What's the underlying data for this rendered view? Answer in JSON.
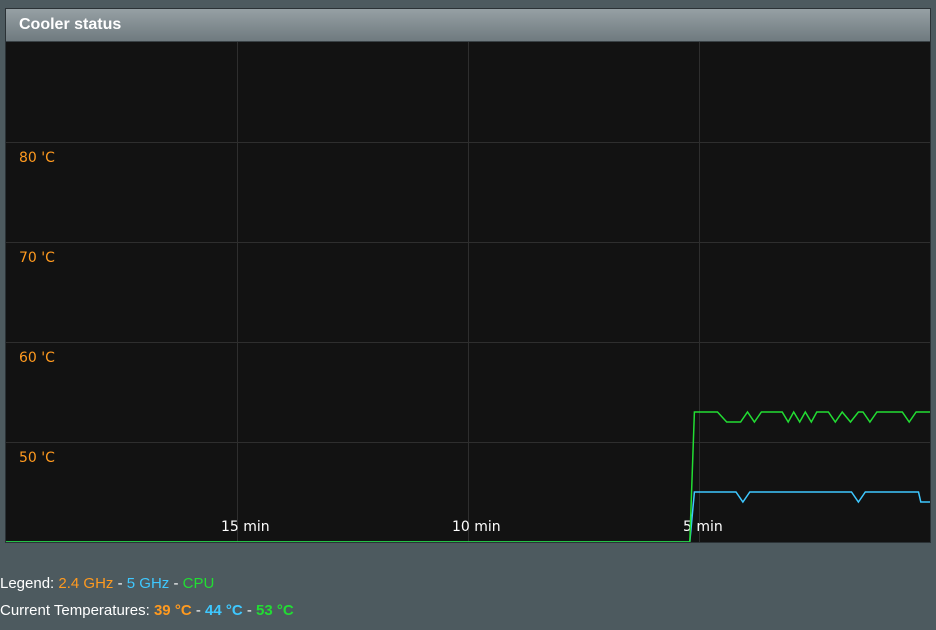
{
  "panel": {
    "title": "Cooler status"
  },
  "legend": {
    "label": "Legend: ",
    "sep": " - ",
    "items": [
      "2.4 GHz",
      "5 GHz",
      "CPU"
    ]
  },
  "current": {
    "label": "Current Temperatures: ",
    "sep": " - ",
    "values": [
      "39 °C",
      "44 °C",
      "53 °C"
    ]
  },
  "colors": {
    "ghz24": "#ff9a1f",
    "ghz5": "#3ec8ff",
    "cpu": "#22dd33",
    "grid": "#2e2e2e",
    "background": "#121212"
  },
  "chart_data": {
    "type": "line",
    "title": "Cooler status",
    "xlabel": "",
    "ylabel": "",
    "x_unit": "minutes ago",
    "xlim": [
      20,
      0
    ],
    "ylim": [
      40,
      90
    ],
    "y_ticks": [
      {
        "value": 50,
        "label": "50 'C"
      },
      {
        "value": 60,
        "label": "60 'C"
      },
      {
        "value": 70,
        "label": "70 'C"
      },
      {
        "value": 80,
        "label": "80 'C"
      }
    ],
    "x_ticks": [
      {
        "value": 15,
        "label": "15 min"
      },
      {
        "value": 10,
        "label": "10 min"
      },
      {
        "value": 5,
        "label": "5 min"
      }
    ],
    "grid": true,
    "series": [
      {
        "name": "2.4 GHz",
        "color": "#ff9a1f",
        "points": []
      },
      {
        "name": "5 GHz",
        "color": "#3ec8ff",
        "points": [
          [
            20,
            40
          ],
          [
            5.2,
            40
          ],
          [
            5.1,
            45
          ],
          [
            4.2,
            45
          ],
          [
            4.05,
            44
          ],
          [
            3.9,
            45
          ],
          [
            1.7,
            45
          ],
          [
            1.55,
            44
          ],
          [
            1.4,
            45
          ],
          [
            0.5,
            45
          ],
          [
            0.25,
            45
          ],
          [
            0.2,
            44
          ],
          [
            0,
            44
          ]
        ]
      },
      {
        "name": "CPU",
        "color": "#22dd33",
        "points": [
          [
            20,
            40
          ],
          [
            5.2,
            40
          ],
          [
            5.1,
            53
          ],
          [
            4.6,
            53
          ],
          [
            4.4,
            52
          ],
          [
            4.1,
            52
          ],
          [
            3.95,
            53
          ],
          [
            3.8,
            52
          ],
          [
            3.65,
            53
          ],
          [
            3.2,
            53
          ],
          [
            3.07,
            52
          ],
          [
            2.95,
            53
          ],
          [
            2.82,
            52
          ],
          [
            2.7,
            53
          ],
          [
            2.57,
            52
          ],
          [
            2.45,
            53
          ],
          [
            2.2,
            53
          ],
          [
            2.05,
            52
          ],
          [
            1.9,
            53
          ],
          [
            1.72,
            52
          ],
          [
            1.55,
            53
          ],
          [
            1.45,
            53
          ],
          [
            1.3,
            52
          ],
          [
            1.15,
            53
          ],
          [
            0.6,
            53
          ],
          [
            0.45,
            52
          ],
          [
            0.3,
            53
          ],
          [
            0,
            53
          ]
        ]
      }
    ]
  }
}
